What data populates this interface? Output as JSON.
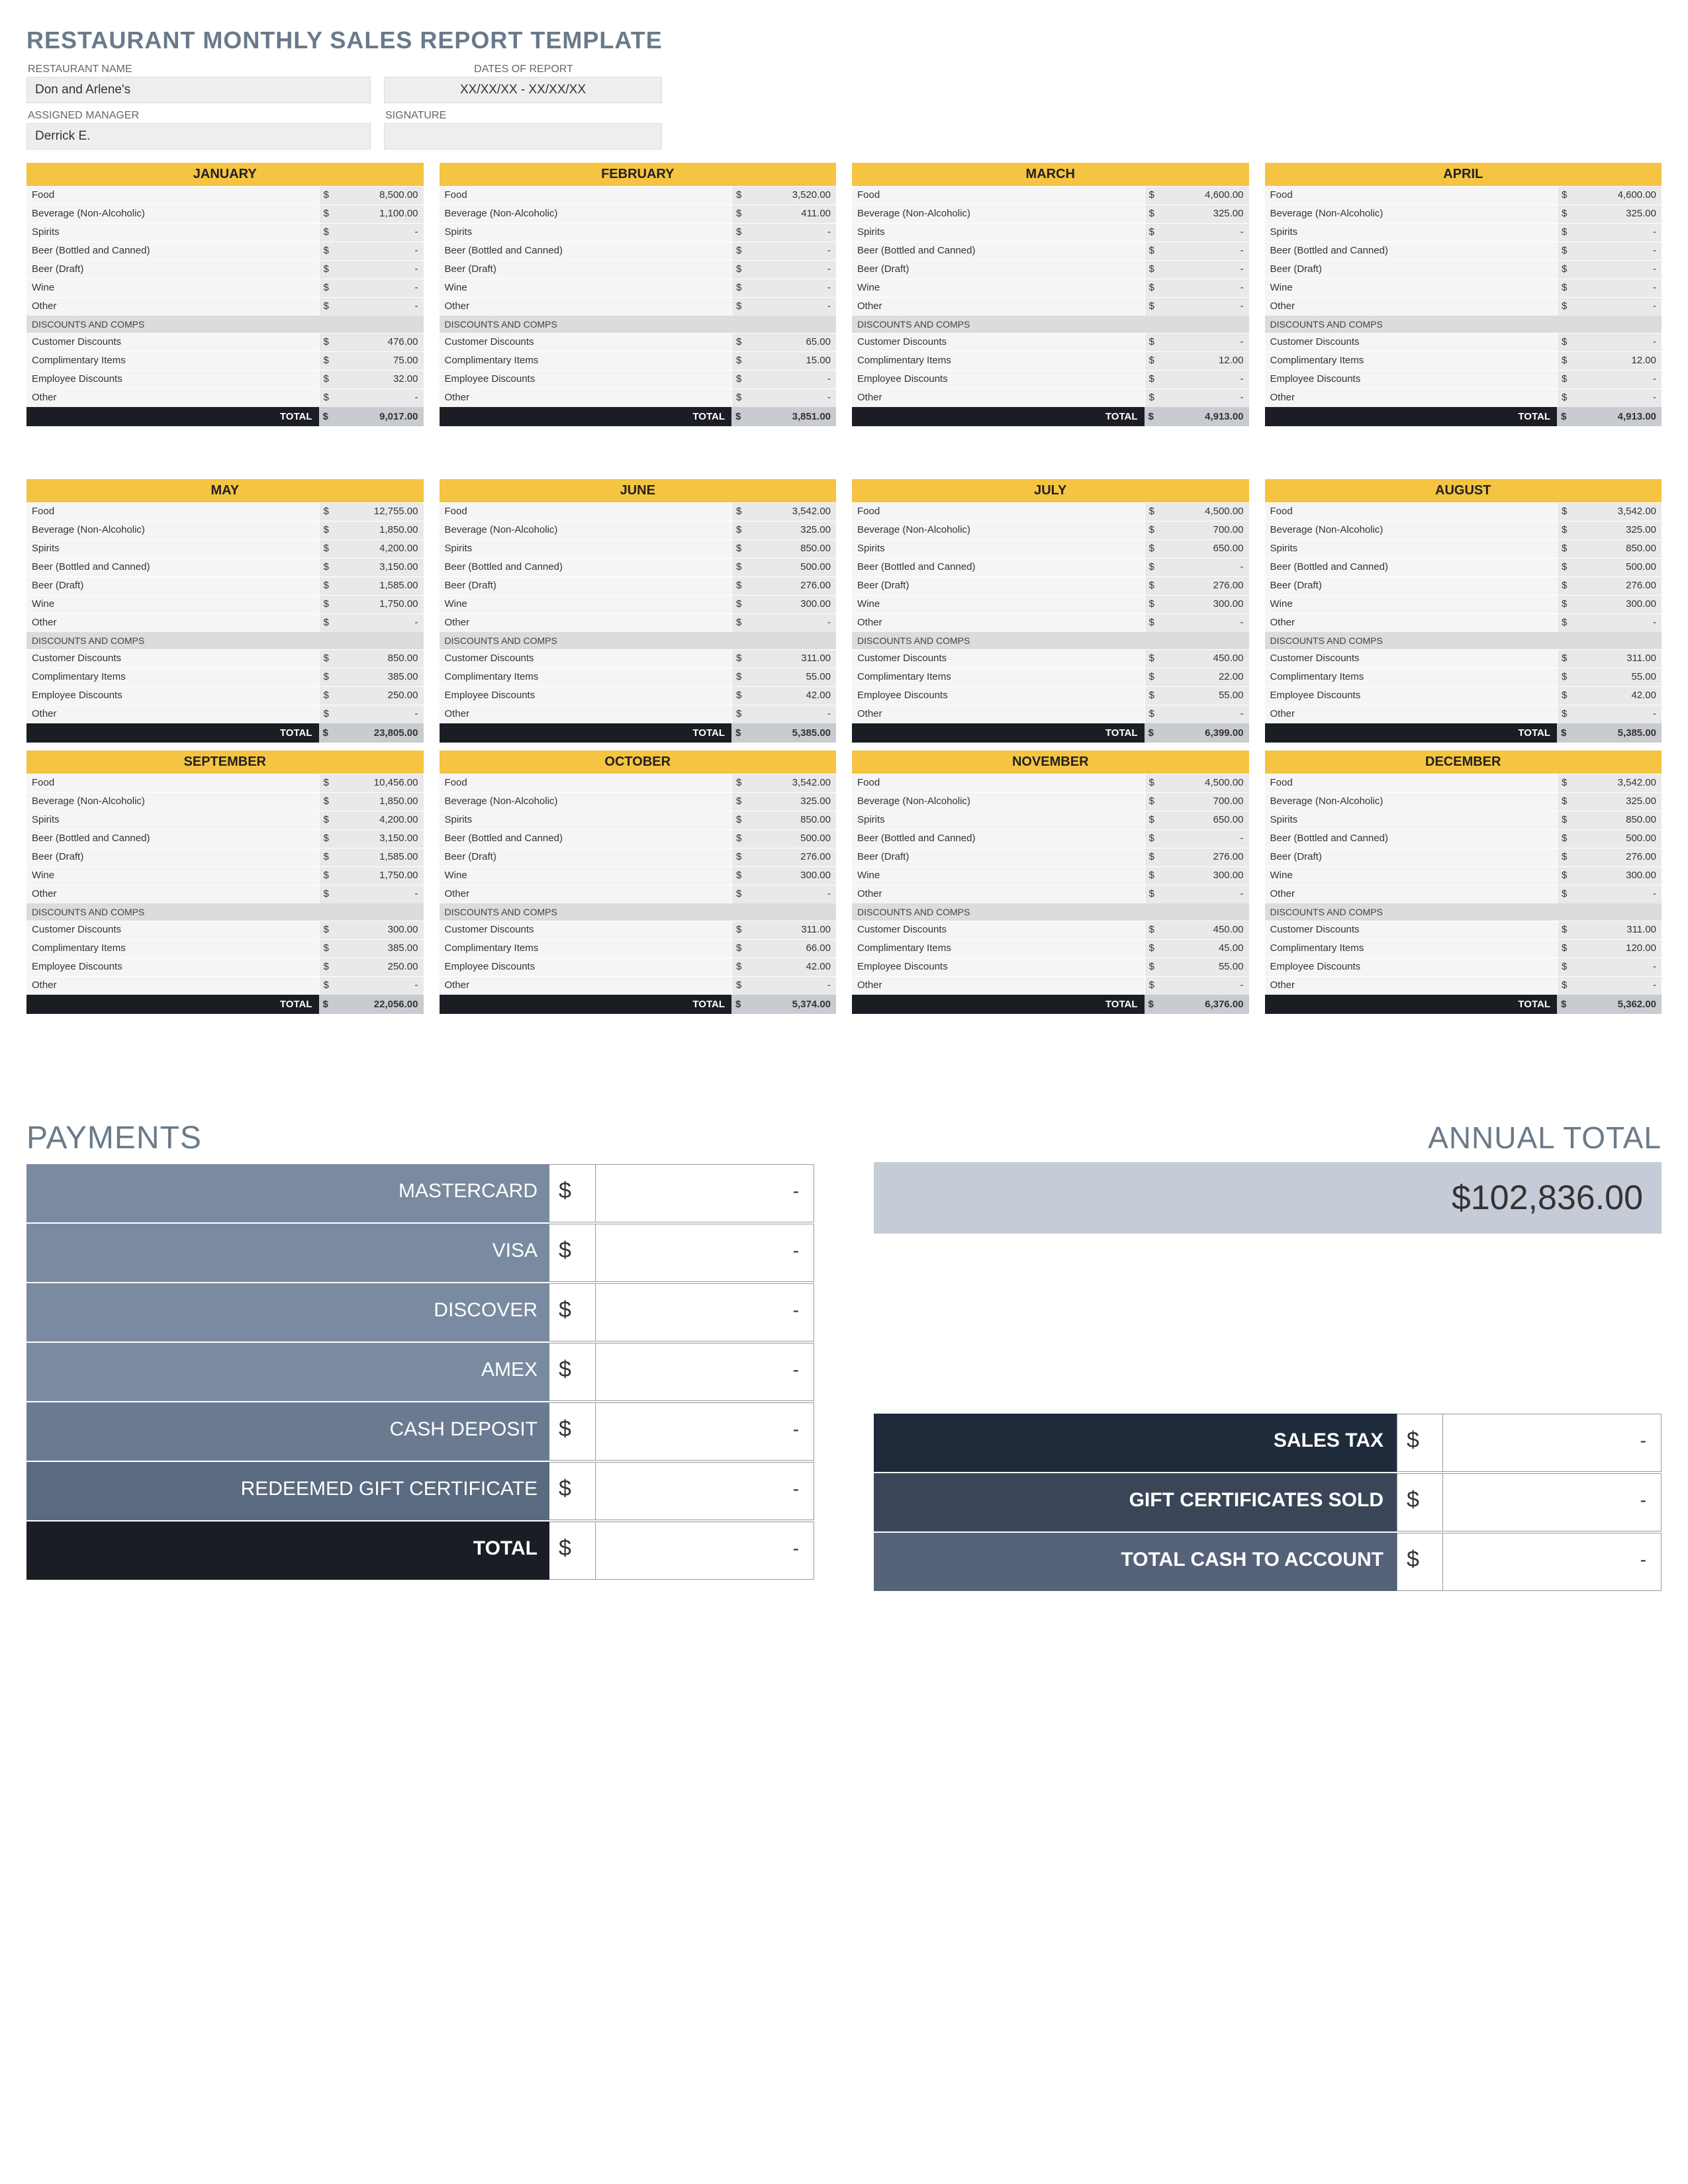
{
  "title": "RESTAURANT MONTHLY SALES REPORT TEMPLATE",
  "labels": {
    "restaurant_name": "RESTAURANT NAME",
    "dates_of_report": "DATES OF REPORT",
    "assigned_manager": "ASSIGNED MANAGER",
    "signature": "SIGNATURE",
    "discounts_comps": "DISCOUNTS AND COMPS",
    "total": "TOTAL"
  },
  "info": {
    "restaurant_name": "Don and Arlene's",
    "dates_of_report": "XX/XX/XX - XX/XX/XX",
    "assigned_manager": "Derrick E.",
    "signature": ""
  },
  "sales_categories": [
    "Food",
    "Beverage (Non-Alcoholic)",
    "Spirits",
    "Beer (Bottled and Canned)",
    "Beer (Draft)",
    "Wine",
    "Other"
  ],
  "discount_categories": [
    "Customer Discounts",
    "Complimentary Items",
    "Employee Discounts",
    "Other"
  ],
  "months": [
    {
      "name": "JANUARY",
      "sales": [
        "8,500.00",
        "1,100.00",
        "-",
        "-",
        "-",
        "-",
        "-"
      ],
      "discounts": [
        "476.00",
        "75.00",
        "32.00",
        "-"
      ],
      "total": "9,017.00"
    },
    {
      "name": "FEBRUARY",
      "sales": [
        "3,520.00",
        "411.00",
        "-",
        "-",
        "-",
        "-",
        "-"
      ],
      "discounts": [
        "65.00",
        "15.00",
        "-",
        "-"
      ],
      "total": "3,851.00"
    },
    {
      "name": "MARCH",
      "sales": [
        "4,600.00",
        "325.00",
        "-",
        "-",
        "-",
        "-",
        "-"
      ],
      "discounts": [
        "-",
        "12.00",
        "-",
        "-"
      ],
      "total": "4,913.00"
    },
    {
      "name": "APRIL",
      "sales": [
        "4,600.00",
        "325.00",
        "-",
        "-",
        "-",
        "-",
        "-"
      ],
      "discounts": [
        "-",
        "12.00",
        "-",
        "-"
      ],
      "total": "4,913.00"
    },
    {
      "name": "MAY",
      "sales": [
        "12,755.00",
        "1,850.00",
        "4,200.00",
        "3,150.00",
        "1,585.00",
        "1,750.00",
        "-"
      ],
      "discounts": [
        "850.00",
        "385.00",
        "250.00",
        "-"
      ],
      "total": "23,805.00"
    },
    {
      "name": "JUNE",
      "sales": [
        "3,542.00",
        "325.00",
        "850.00",
        "500.00",
        "276.00",
        "300.00",
        "-"
      ],
      "discounts": [
        "311.00",
        "55.00",
        "42.00",
        "-"
      ],
      "total": "5,385.00"
    },
    {
      "name": "JULY",
      "sales": [
        "4,500.00",
        "700.00",
        "650.00",
        "-",
        "276.00",
        "300.00",
        "-"
      ],
      "discounts": [
        "450.00",
        "22.00",
        "55.00",
        "-"
      ],
      "total": "6,399.00"
    },
    {
      "name": "AUGUST",
      "sales": [
        "3,542.00",
        "325.00",
        "850.00",
        "500.00",
        "276.00",
        "300.00",
        "-"
      ],
      "discounts": [
        "311.00",
        "55.00",
        "42.00",
        "-"
      ],
      "total": "5,385.00"
    },
    {
      "name": "SEPTEMBER",
      "sales": [
        "10,456.00",
        "1,850.00",
        "4,200.00",
        "3,150.00",
        "1,585.00",
        "1,750.00",
        "-"
      ],
      "discounts": [
        "300.00",
        "385.00",
        "250.00",
        "-"
      ],
      "total": "22,056.00"
    },
    {
      "name": "OCTOBER",
      "sales": [
        "3,542.00",
        "325.00",
        "850.00",
        "500.00",
        "276.00",
        "300.00",
        "-"
      ],
      "discounts": [
        "311.00",
        "66.00",
        "42.00",
        "-"
      ],
      "total": "5,374.00"
    },
    {
      "name": "NOVEMBER",
      "sales": [
        "4,500.00",
        "700.00",
        "650.00",
        "-",
        "276.00",
        "300.00",
        "-"
      ],
      "discounts": [
        "450.00",
        "45.00",
        "55.00",
        "-"
      ],
      "total": "6,376.00"
    },
    {
      "name": "DECEMBER",
      "sales": [
        "3,542.00",
        "325.00",
        "850.00",
        "500.00",
        "276.00",
        "300.00",
        "-"
      ],
      "discounts": [
        "311.00",
        "120.00",
        "-",
        "-"
      ],
      "total": "5,362.00"
    }
  ],
  "payments_header": "PAYMENTS",
  "payments": [
    {
      "label": "MASTERCARD",
      "value": "-"
    },
    {
      "label": "VISA",
      "value": "-"
    },
    {
      "label": "DISCOVER",
      "value": "-"
    },
    {
      "label": "AMEX",
      "value": "-"
    },
    {
      "label": "CASH DEPOSIT",
      "value": "-",
      "class": "cash"
    },
    {
      "label": "REDEEMED GIFT CERTIFICATE",
      "value": "-",
      "class": "gift"
    },
    {
      "label": "TOTAL",
      "value": "-",
      "class": "total"
    }
  ],
  "annual_header": "ANNUAL TOTAL",
  "annual_total": "$102,836.00",
  "summary": [
    {
      "label": "SALES TAX",
      "value": "-",
      "class": "s1"
    },
    {
      "label": "GIFT CERTIFICATES SOLD",
      "value": "-",
      "class": "s2"
    },
    {
      "label": "TOTAL CASH TO ACCOUNT",
      "value": "-",
      "class": "s3"
    }
  ],
  "currency": "$"
}
